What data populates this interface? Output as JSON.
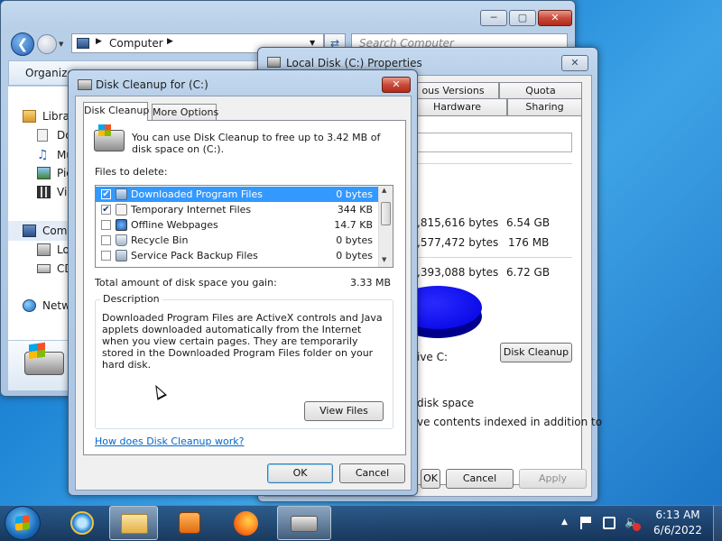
{
  "explorer": {
    "address_segment": "Computer",
    "search_placeholder": "Search Computer",
    "organize_label": "Organize",
    "nav_items": [
      {
        "label": "Libra"
      },
      {
        "label": "Do"
      },
      {
        "label": "Mu"
      },
      {
        "label": "Pic"
      },
      {
        "label": "Vid"
      },
      {
        "label": "Com"
      },
      {
        "label": "Loc"
      },
      {
        "label": "CD"
      },
      {
        "label": "Netw"
      }
    ],
    "caption_min": "─",
    "caption_max": "▢",
    "caption_close": "✕"
  },
  "properties": {
    "title": "Local Disk (C:) Properties",
    "tabs": [
      "ous Versions",
      "Quota",
      "Hardware",
      "Sharing"
    ],
    "used_bytes": ",815,616 bytes",
    "used_size": "6.54 GB",
    "free_bytes": ",577,472 bytes",
    "free_size": "176 MB",
    "capacity_bytes": ",393,088 bytes",
    "capacity_size": "6.72 GB",
    "drive_label": "ive C:",
    "disk_cleanup_label": "Disk Cleanup",
    "compress_text": "disk space",
    "index_text": "ve contents indexed in addition to",
    "ok_label": "OK",
    "cancel_label": "Cancel",
    "apply_label": "Apply",
    "close_glyph": "✕"
  },
  "cleanup": {
    "title": "Disk Cleanup for  (C:)",
    "close_glyph": "✕",
    "tab_cleanup": "Disk Cleanup",
    "tab_more": "More Options",
    "intro": "You can use Disk Cleanup to free up to 3.42 MB of disk space on  (C:).",
    "files_to_delete": "Files to delete:",
    "files": [
      {
        "name": "Downloaded Program Files",
        "size": "0 bytes",
        "checked": "✔"
      },
      {
        "name": "Temporary Internet Files",
        "size": "344 KB",
        "checked": "✔"
      },
      {
        "name": "Offline Webpages",
        "size": "14.7 KB",
        "checked": ""
      },
      {
        "name": "Recycle Bin",
        "size": "0 bytes",
        "checked": ""
      },
      {
        "name": "Service Pack Backup Files",
        "size": "0 bytes",
        "checked": ""
      }
    ],
    "total_label": "Total amount of disk space you gain:",
    "total_value": "3.33 MB",
    "description_legend": "Description",
    "description_text": "Downloaded Program Files are ActiveX controls and Java applets downloaded automatically from the Internet when you view certain pages. They are temporarily stored in the Downloaded Program Files folder on your hard disk.",
    "view_files_label": "View Files",
    "help_link": "How does Disk Cleanup work?",
    "ok_label": "OK",
    "cancel_label": "Cancel",
    "scroll_up": "▲",
    "scroll_down": "▼"
  },
  "taskbar": {
    "time": "6:13 AM",
    "date": "6/6/2022",
    "tray_arrow": "▲"
  }
}
